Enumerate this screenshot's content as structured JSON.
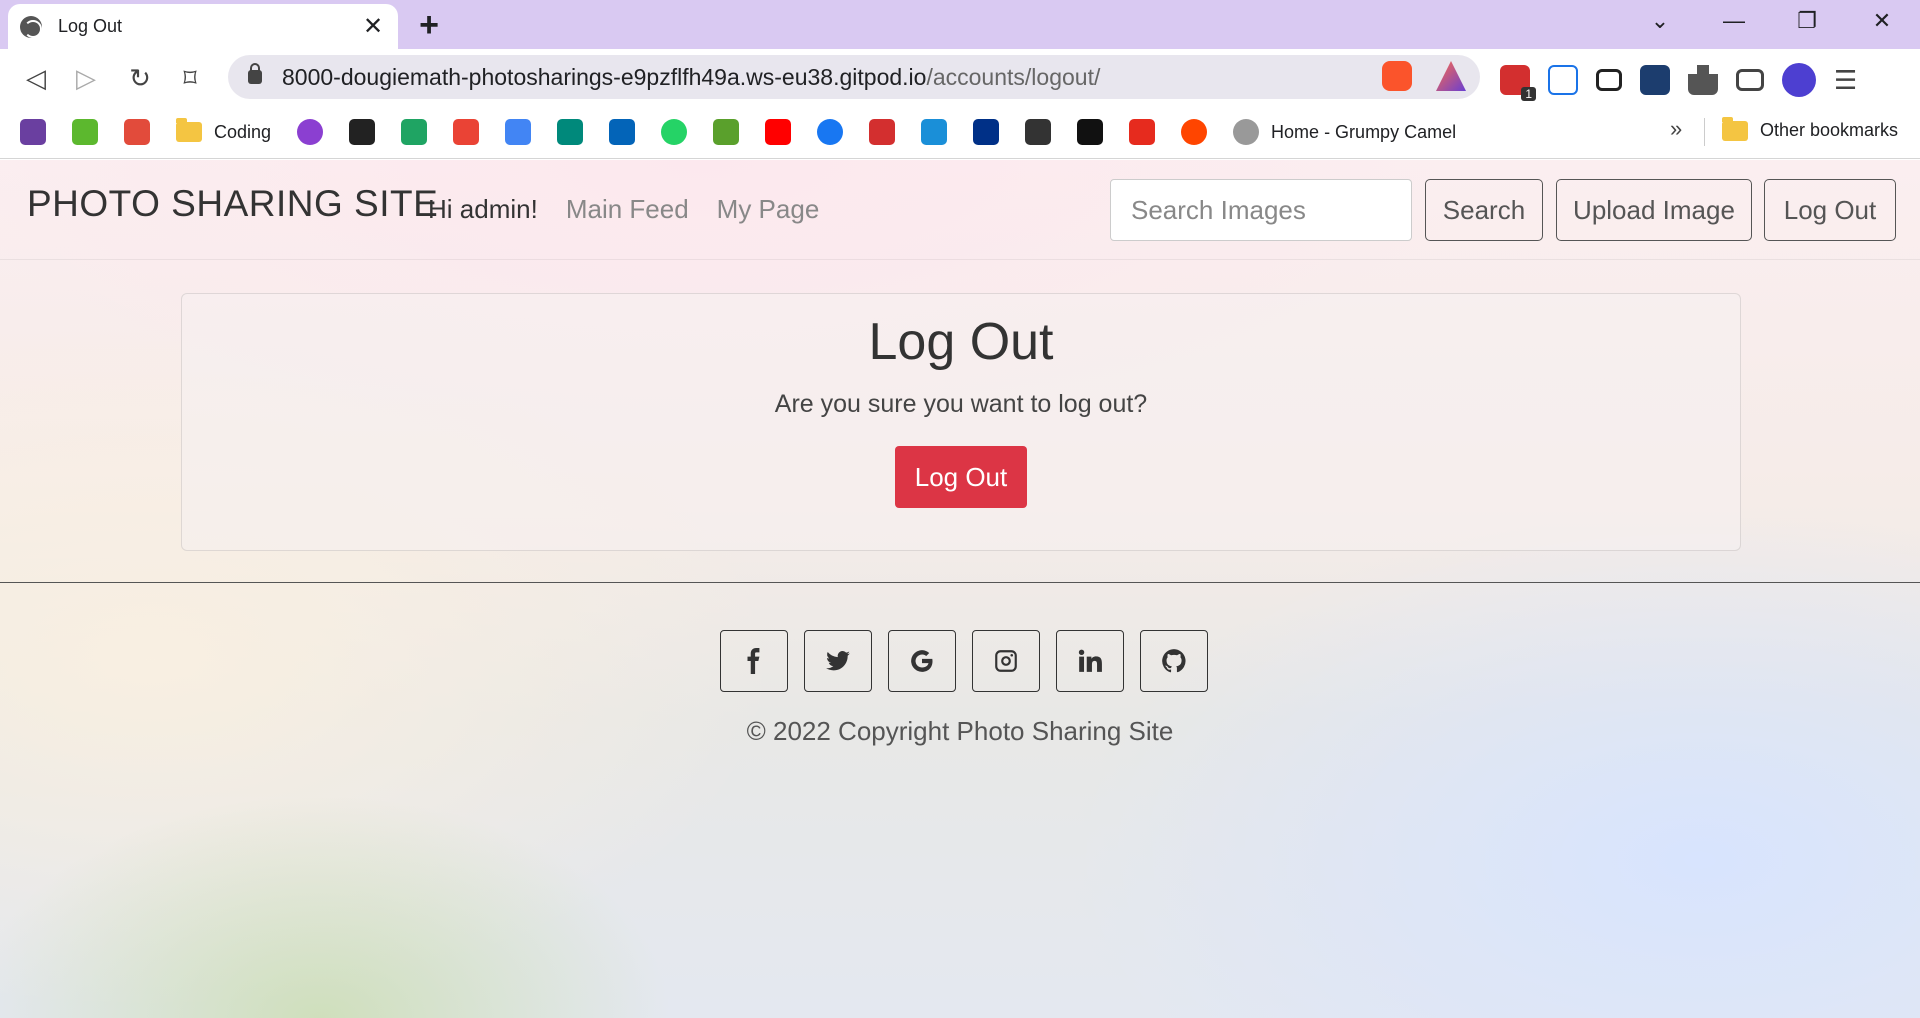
{
  "browser": {
    "tab_title": "Log Out",
    "new_tab_symbol": "+",
    "url_host": "8000-dougiemath-photosharings-e9pzflfh49a.ws-eu38.gitpod.io",
    "url_path": "/accounts/logout/",
    "bookmarks": [
      {
        "label": "",
        "icon": "bookmark-site-icon",
        "color": "#6a3fa0"
      },
      {
        "label": "",
        "icon": "e-icon",
        "color": "#5cb82e"
      },
      {
        "label": "",
        "icon": "ii-icon",
        "color": "#e24b3b"
      },
      {
        "label": "Coding",
        "icon": "folder-icon",
        "color": "#f4c542"
      },
      {
        "label": "",
        "icon": "u-icon",
        "color": "#8b3fd1"
      },
      {
        "label": "",
        "icon": "amazon-icon",
        "color": "#222222"
      },
      {
        "label": "",
        "icon": "drive-icon",
        "color": "#1fa463"
      },
      {
        "label": "",
        "icon": "gmail-icon",
        "color": "#ea4335"
      },
      {
        "label": "",
        "icon": "calendar-icon",
        "color": "#4285f4"
      },
      {
        "label": "",
        "icon": "meet-icon",
        "color": "#00897b"
      },
      {
        "label": "",
        "icon": "onedrive-icon",
        "color": "#0364b8"
      },
      {
        "label": "",
        "icon": "whatsapp-icon",
        "color": "#25d366"
      },
      {
        "label": "",
        "icon": "a-icon",
        "color": "#5aa02c"
      },
      {
        "label": "",
        "icon": "youtube-icon",
        "color": "#ff0000"
      },
      {
        "label": "",
        "icon": "facebook-icon",
        "color": "#1877f2"
      },
      {
        "label": "",
        "icon": "dots-red-icon",
        "color": "#d32f2f"
      },
      {
        "label": "",
        "icon": "translate-icon",
        "color": "#1a8fd8"
      },
      {
        "label": "",
        "icon": "paypal-icon",
        "color": "#003087"
      },
      {
        "label": "",
        "icon": "qr-icon",
        "color": "#333333"
      },
      {
        "label": "",
        "icon": "dots-black-icon",
        "color": "#111111"
      },
      {
        "label": "",
        "icon": "ted-icon",
        "color": "#e62b1e"
      },
      {
        "label": "",
        "icon": "reddit-icon",
        "color": "#ff4500"
      },
      {
        "label": "Home - Grumpy Camel",
        "icon": "camel-icon",
        "color": "#999999"
      }
    ],
    "more_bookmarks": "»",
    "other_bookmarks": "Other bookmarks",
    "extension_badge": "1"
  },
  "navbar": {
    "brand": "PHOTO SHARING SITE",
    "greeting": "Hi admin!",
    "links": [
      "Main Feed",
      "My Page"
    ],
    "search_placeholder": "Search Images",
    "search_button": "Search",
    "upload_button": "Upload Image",
    "logout_button": "Log Out"
  },
  "card": {
    "title": "Log Out",
    "message": "Are you sure you want to log out?",
    "confirm_button": "Log Out"
  },
  "footer": {
    "social": [
      "facebook-icon",
      "twitter-icon",
      "google-icon",
      "instagram-icon",
      "linkedin-icon",
      "github-icon"
    ],
    "copyright": "© 2022 Copyright Photo Sharing Site"
  },
  "colors": {
    "danger": "#dc3545",
    "tabbar": "#d9c9f2"
  }
}
